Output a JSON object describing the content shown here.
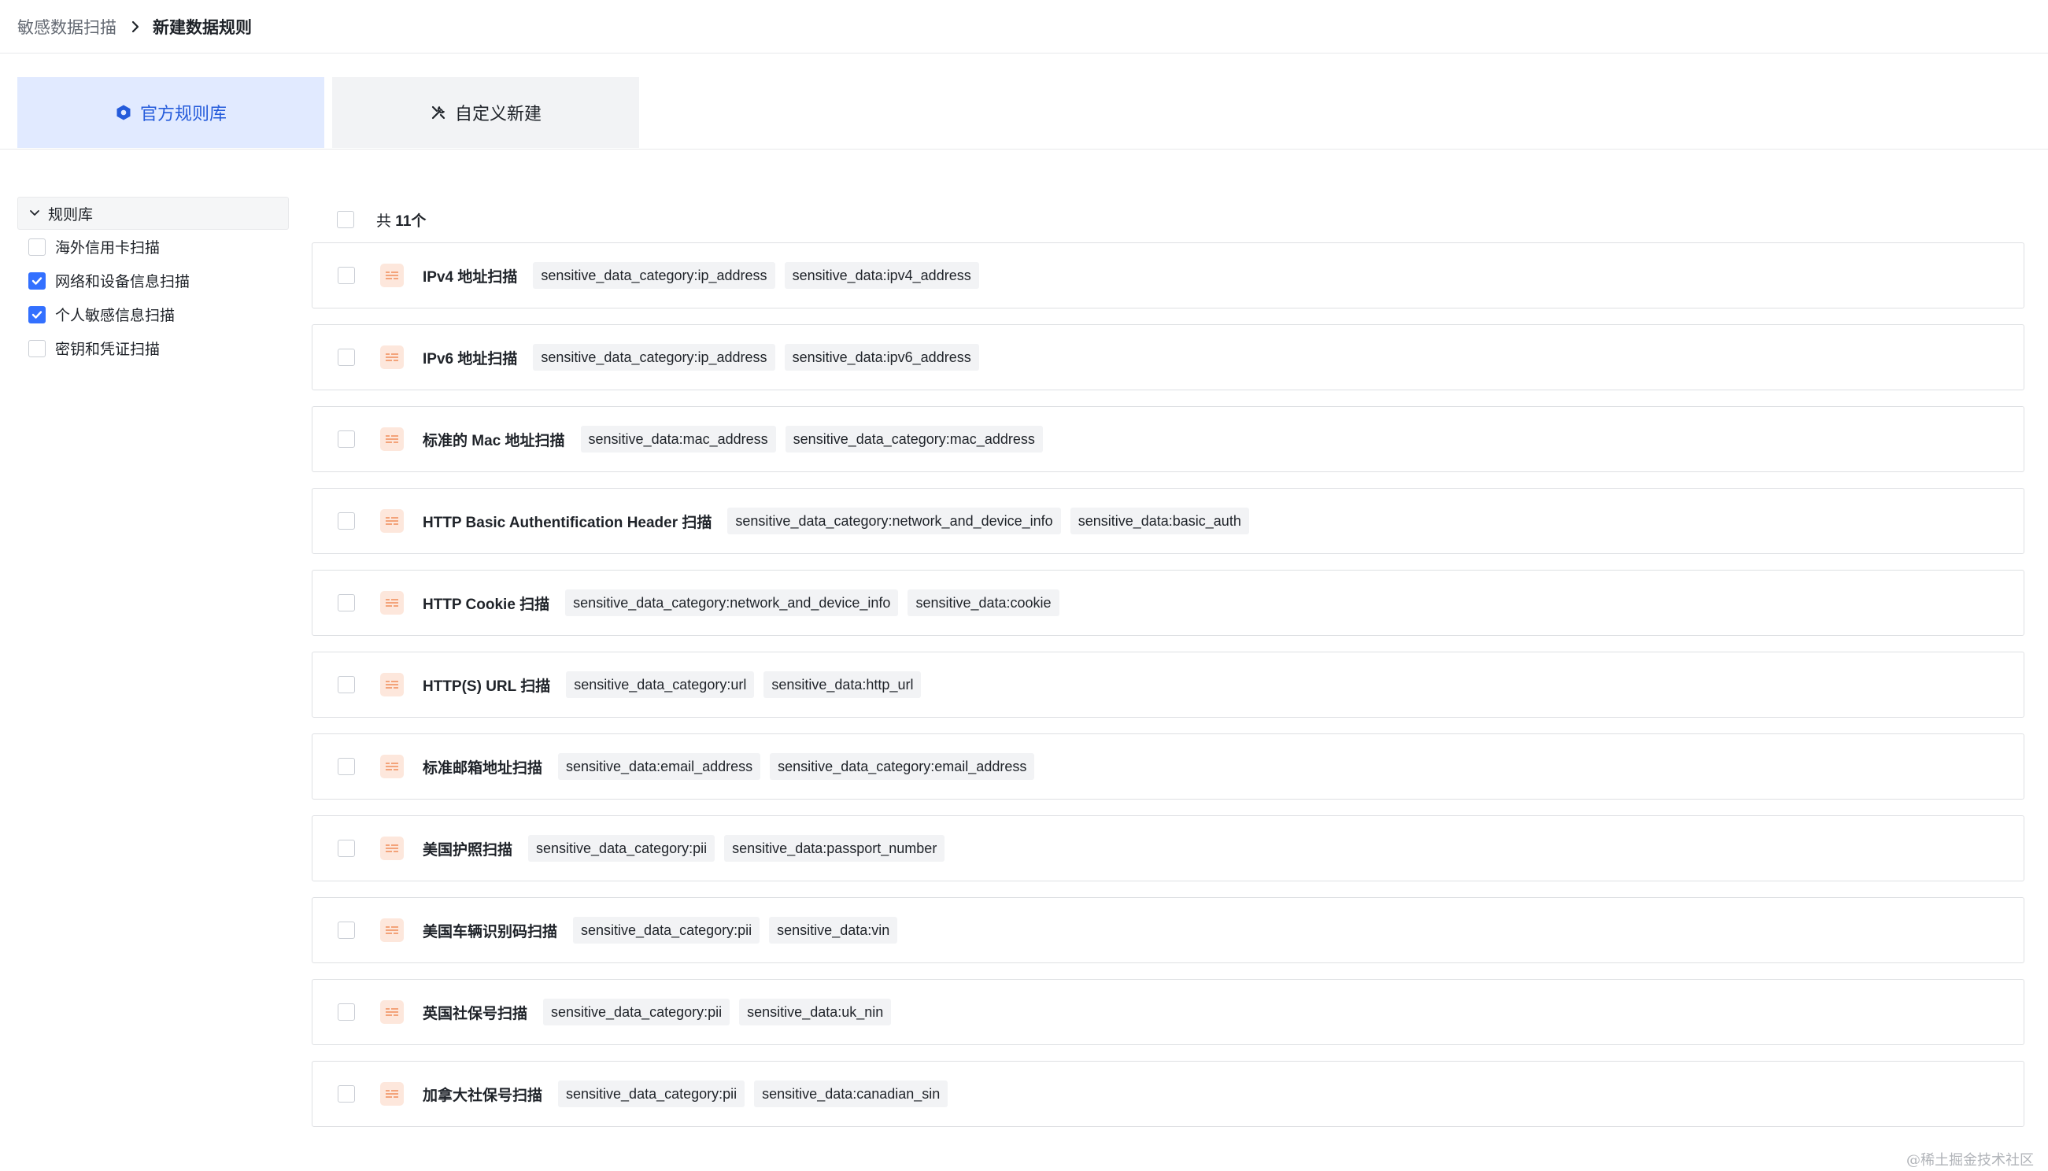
{
  "breadcrumb": {
    "parent": "敏感数据扫描",
    "current": "新建数据规则"
  },
  "tabs": [
    {
      "label": "官方规则库",
      "icon": "shield-hexagon-icon",
      "active": true
    },
    {
      "label": "自定义新建",
      "icon": "tools-icon",
      "active": false
    }
  ],
  "sidebar": {
    "group_label": "规则库",
    "items": [
      {
        "label": "海外信用卡扫描",
        "checked": false
      },
      {
        "label": "网络和设备信息扫描",
        "checked": true
      },
      {
        "label": "个人敏感信息扫描",
        "checked": true
      },
      {
        "label": "密钥和凭证扫描",
        "checked": false
      }
    ]
  },
  "list": {
    "total_prefix": "共",
    "total_count": "11个",
    "rules": [
      {
        "name": "IPv4 地址扫描",
        "tags": [
          "sensitive_data_category:ip_address",
          "sensitive_data:ipv4_address"
        ]
      },
      {
        "name": "IPv6 地址扫描",
        "tags": [
          "sensitive_data_category:ip_address",
          "sensitive_data:ipv6_address"
        ]
      },
      {
        "name": "标准的 Mac 地址扫描",
        "tags": [
          "sensitive_data:mac_address",
          "sensitive_data_category:mac_address"
        ]
      },
      {
        "name": "HTTP Basic Authentification Header 扫描",
        "tags": [
          "sensitive_data_category:network_and_device_info",
          "sensitive_data:basic_auth"
        ]
      },
      {
        "name": "HTTP Cookie 扫描",
        "tags": [
          "sensitive_data_category:network_and_device_info",
          "sensitive_data:cookie"
        ]
      },
      {
        "name": "HTTP(S) URL 扫描",
        "tags": [
          "sensitive_data_category:url",
          "sensitive_data:http_url"
        ]
      },
      {
        "name": "标准邮箱地址扫描",
        "tags": [
          "sensitive_data:email_address",
          "sensitive_data_category:email_address"
        ]
      },
      {
        "name": "美国护照扫描",
        "tags": [
          "sensitive_data_category:pii",
          "sensitive_data:passport_number"
        ]
      },
      {
        "name": "美国车辆识别码扫描",
        "tags": [
          "sensitive_data_category:pii",
          "sensitive_data:vin"
        ]
      },
      {
        "name": "英国社保号扫描",
        "tags": [
          "sensitive_data_category:pii",
          "sensitive_data:uk_nin"
        ]
      },
      {
        "name": "加拿大社保号扫描",
        "tags": [
          "sensitive_data_category:pii",
          "sensitive_data:canadian_sin"
        ]
      }
    ]
  },
  "watermark": "@稀土掘金技术社区",
  "colors": {
    "accent": "#3370ff",
    "active_tab_bg": "#e1eaff",
    "active_tab_text": "#245bdb",
    "rule_icon_bg": "#fde7dc",
    "rule_icon_fg": "#f3a37a"
  }
}
